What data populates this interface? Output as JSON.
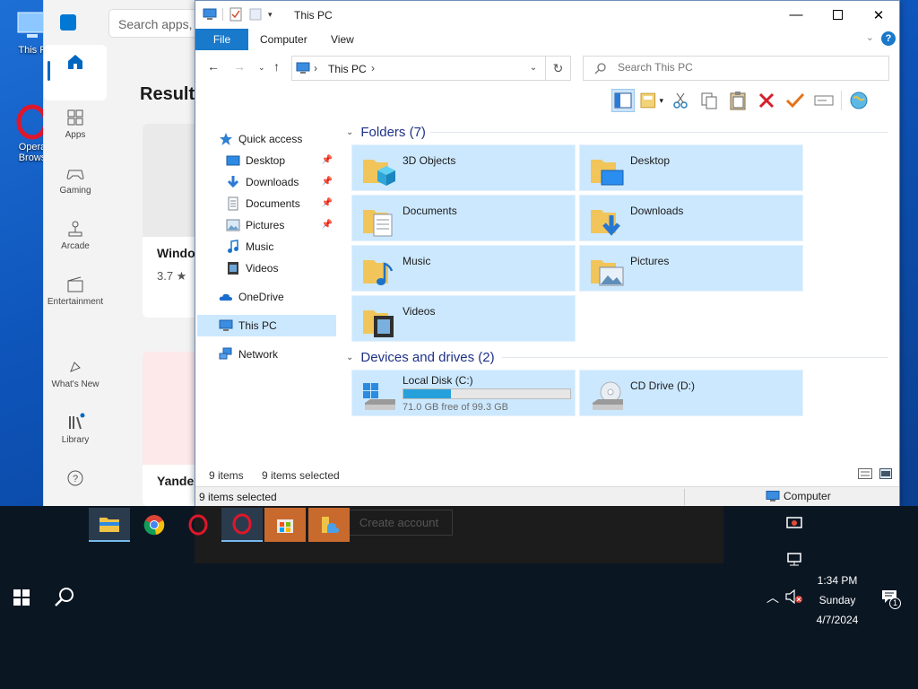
{
  "desktop": {
    "icons": [
      {
        "label": "This P",
        "icon": "this-pc-icon"
      },
      {
        "label": "Opera Brows",
        "icon": "opera-icon"
      }
    ]
  },
  "store": {
    "search_placeholder": "Search apps, g",
    "results_heading": "Results",
    "nav": [
      {
        "label": "",
        "icon": "home-icon"
      },
      {
        "label": "Apps",
        "icon": "apps-icon"
      },
      {
        "label": "Gaming",
        "icon": "gaming-icon"
      },
      {
        "label": "Arcade",
        "icon": "arcade-icon"
      },
      {
        "label": "Entertainment",
        "icon": "entertainment-icon"
      },
      {
        "label": "What's New",
        "icon": "whats-new-icon"
      },
      {
        "label": "Library",
        "icon": "library-icon"
      },
      {
        "label": "",
        "icon": "help-icon"
      }
    ],
    "cards": [
      {
        "title": "Windo",
        "rating": "3.7 ★"
      },
      {
        "title": "Yandex",
        "rating": ""
      }
    ]
  },
  "explorer": {
    "title": "This PC",
    "ribbon_tabs": [
      "File",
      "Computer",
      "View"
    ],
    "help_label": "?",
    "address": {
      "crumb": "This PC"
    },
    "search_placeholder": "Search This PC",
    "nav_pane": [
      {
        "label": "Quick access",
        "icon": "star-icon",
        "level": 0,
        "pinned": false
      },
      {
        "label": "Desktop",
        "icon": "desktop-folder-icon",
        "level": 1,
        "pinned": true
      },
      {
        "label": "Downloads",
        "icon": "downloads-folder-icon",
        "level": 1,
        "pinned": true
      },
      {
        "label": "Documents",
        "icon": "documents-folder-icon",
        "level": 1,
        "pinned": true
      },
      {
        "label": "Pictures",
        "icon": "pictures-folder-icon",
        "level": 1,
        "pinned": true
      },
      {
        "label": "Music",
        "icon": "music-folder-icon",
        "level": 1,
        "pinned": false
      },
      {
        "label": "Videos",
        "icon": "videos-folder-icon",
        "level": 1,
        "pinned": false
      },
      {
        "label": "OneDrive",
        "icon": "onedrive-icon",
        "level": 0,
        "pinned": false
      },
      {
        "label": "This PC",
        "icon": "this-pc-icon",
        "level": 0,
        "pinned": false
      },
      {
        "label": "Network",
        "icon": "network-icon",
        "level": 0,
        "pinned": false
      }
    ],
    "folders_header": "Folders (7)",
    "folders": [
      {
        "name": "3D Objects",
        "icon": "3d-objects-folder-icon"
      },
      {
        "name": "Desktop",
        "icon": "desktop-folder-icon"
      },
      {
        "name": "Documents",
        "icon": "documents-folder-icon"
      },
      {
        "name": "Downloads",
        "icon": "downloads-folder-icon"
      },
      {
        "name": "Music",
        "icon": "music-folder-icon"
      },
      {
        "name": "Pictures",
        "icon": "pictures-folder-icon"
      },
      {
        "name": "Videos",
        "icon": "videos-folder-icon"
      }
    ],
    "drives_header": "Devices and drives (2)",
    "drives": [
      {
        "name": "Local Disk (C:)",
        "icon": "hard-disk-icon",
        "free_text": "71.0 GB free of 99.3 GB",
        "used_fraction": 0.285
      },
      {
        "name": "CD Drive (D:)",
        "icon": "cd-drive-icon",
        "free_text": "",
        "used_fraction": null
      }
    ],
    "status": {
      "item_count": "9 items",
      "selected_count": "9 items selected"
    },
    "statusbar": {
      "left": "9 items selected",
      "right": "Computer"
    }
  },
  "taskbar": {
    "dialog_button": "Create account",
    "apps": [
      "file-explorer-icon",
      "chrome-icon",
      "opera-icon",
      "opera-icon",
      "store-icon",
      "explorer-window-icon"
    ],
    "clock": {
      "time": "1:34 PM",
      "day": "Sunday",
      "date": "4/7/2024"
    },
    "notification_count": "1"
  },
  "colors": {
    "accent": "#1979ca",
    "selection": "#cce8ff",
    "taskbar": "#0b1623",
    "desktop": "#0d53b8"
  }
}
